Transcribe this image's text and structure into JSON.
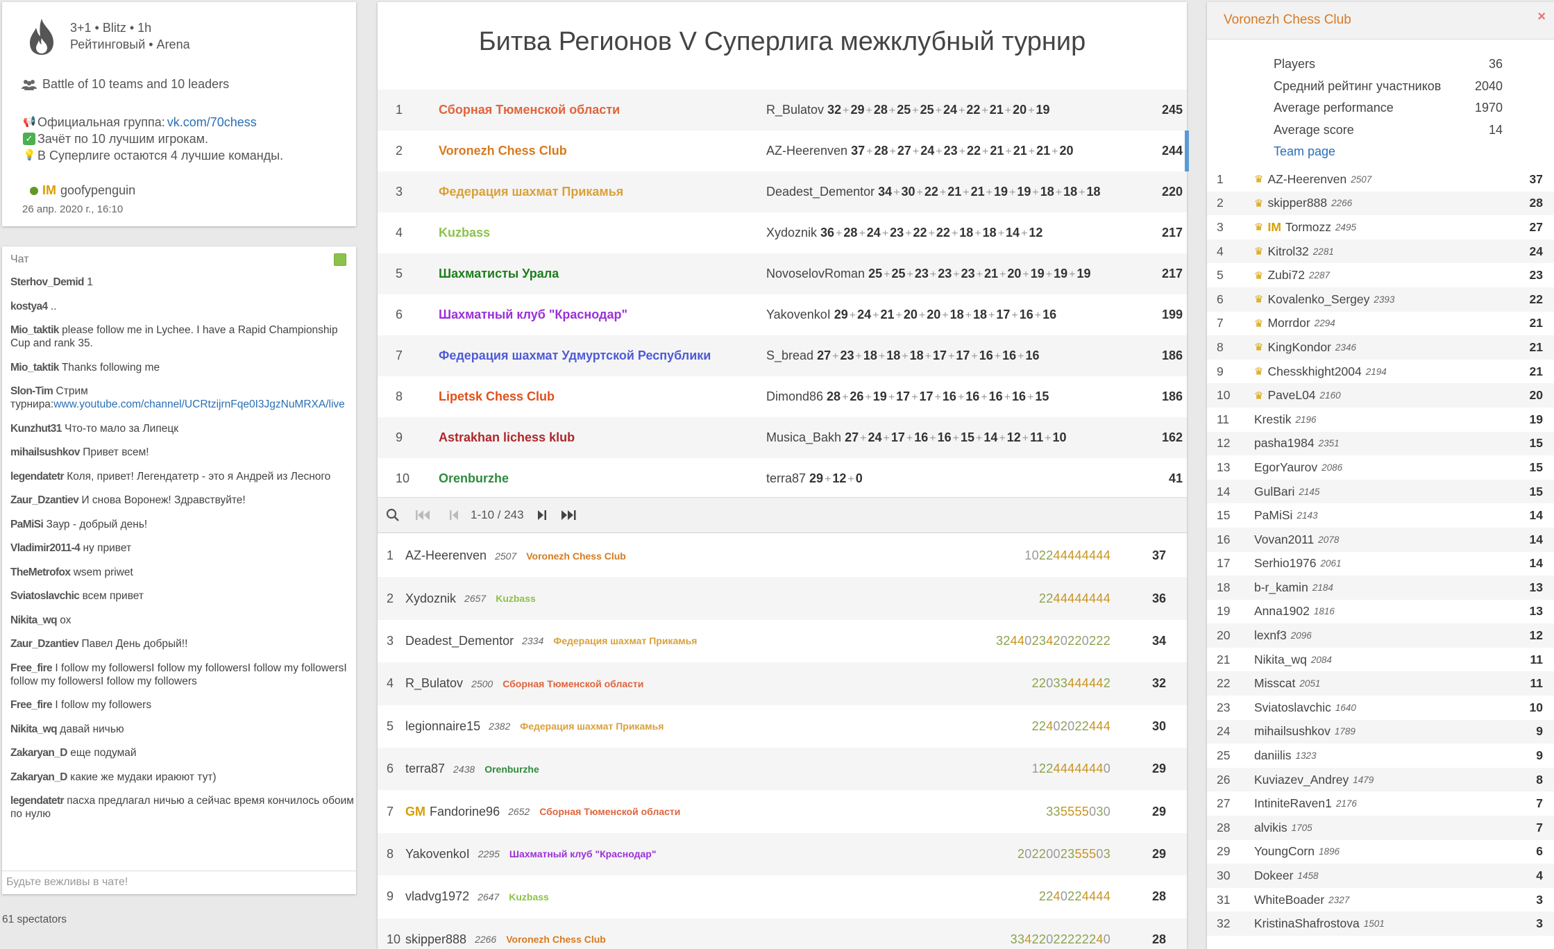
{
  "tournament": {
    "clock": "3+1 • Blitz • 1h",
    "type": "Рейтинговый • Arena",
    "battle": "Battle of 10 teams and 10 leaders",
    "desc_group_label": "Официальная группа: ",
    "desc_group_link": "vk.com/70chess",
    "desc_line2": "Зачёт по 10 лучшим игрокам.",
    "desc_line3": "В Суперлиге остаются 4 лучшие команды.",
    "creator_title": "IM",
    "creator_name": "goofypenguin",
    "date": "26 апр. 2020 г., 16:10",
    "title": "Битва Регионов V Суперлига межклубный турнир"
  },
  "chat": {
    "header": "Чат",
    "placeholder": "Будьте вежливы в чате!",
    "spectators": "61 spectators",
    "messages": [
      {
        "user": "Sterhov_Demid",
        "text": "1"
      },
      {
        "user": "kostya4",
        "text": ".."
      },
      {
        "user": "Mio_taktik",
        "text": "please follow me in Lychee. I have a Rapid Championship Cup and rank 35."
      },
      {
        "user": "Mio_taktik",
        "text": "Thanks following me"
      },
      {
        "user": "Slon-Tim",
        "text": "Стрим турнира:",
        "link": "www.youtube.com/channel/UCRtzijrnFqe0I3JgzNuMRXA/live"
      },
      {
        "user": "Kunzhut31",
        "text": "Что-то мало за Липецк"
      },
      {
        "user": "mihailsushkov",
        "text": "Привет всем!"
      },
      {
        "user": "legendatetr",
        "text": "Коля, привет! Легендатетр - это я Андрей из Лесного"
      },
      {
        "user": "Zaur_Dzantiev",
        "text": "И снова Воронеж! Здравствуйте!"
      },
      {
        "user": "PaMiSi",
        "text": "Заур - добрый день!"
      },
      {
        "user": "Vladimir2011-4",
        "text": "ну привет"
      },
      {
        "user": "TheMetrofox",
        "text": "wsem priwet"
      },
      {
        "user": "Sviatoslavchic",
        "text": "всем привет"
      },
      {
        "user": "Nikita_wq",
        "text": "ох"
      },
      {
        "user": "Zaur_Dzantiev",
        "text": "Павел День добрый!!"
      },
      {
        "user": "Free_fire",
        "text": "I follow my followersI follow my followersI follow my followersI follow my followersI follow my followers"
      },
      {
        "user": "Free_fire",
        "text": "I follow my followers"
      },
      {
        "user": "Nikita_wq",
        "text": "давай ничью"
      },
      {
        "user": "Zakaryan_D",
        "text": "еще подумай"
      },
      {
        "user": "Zakaryan_D",
        "text": "какие же мудаки ираюют тут)"
      },
      {
        "user": "legendatetr",
        "text": "пасха предлагал ничью а сейчас время кончилось обоим по нулю"
      }
    ]
  },
  "teams": [
    {
      "rank": "1",
      "name": "Сборная Тюменской области",
      "color": "#e0643c",
      "leader": "R_Bulatov",
      "scores": [
        "32",
        "29",
        "28",
        "25",
        "25",
        "24",
        "22",
        "21",
        "20",
        "19"
      ],
      "total": "245"
    },
    {
      "rank": "2",
      "name": "Voronezh Chess Club",
      "color": "#d77a20",
      "leader": "AZ-Heerenven",
      "scores": [
        "37",
        "28",
        "27",
        "24",
        "23",
        "22",
        "21",
        "21",
        "21",
        "20"
      ],
      "total": "244"
    },
    {
      "rank": "3",
      "name": "Федерация шахмат Прикамья",
      "color": "#d9a13a",
      "leader": "Deadest_Dementor",
      "scores": [
        "34",
        "30",
        "22",
        "21",
        "21",
        "19",
        "19",
        "18",
        "18",
        "18"
      ],
      "total": "220"
    },
    {
      "rank": "4",
      "name": "Kuzbass",
      "color": "#8bc34a",
      "leader": "Xydoznik",
      "scores": [
        "36",
        "28",
        "24",
        "23",
        "22",
        "22",
        "18",
        "18",
        "14",
        "12"
      ],
      "total": "217"
    },
    {
      "rank": "5",
      "name": "Шахматисты Урала",
      "color": "#1e7d1e",
      "leader": "NovoselovRoman",
      "scores": [
        "25",
        "25",
        "23",
        "23",
        "23",
        "21",
        "20",
        "19",
        "19",
        "19"
      ],
      "total": "217"
    },
    {
      "rank": "6",
      "name": "Шахматный клуб \"Краснодар\"",
      "color": "#9b30d9",
      "leader": "YakovenkoI",
      "scores": [
        "29",
        "24",
        "21",
        "20",
        "20",
        "18",
        "18",
        "17",
        "16",
        "16"
      ],
      "total": "199"
    },
    {
      "rank": "7",
      "name": "Федерация шахмат Удмуртской Республики",
      "color": "#4f5bd5",
      "leader": "S_bread",
      "scores": [
        "27",
        "23",
        "18",
        "18",
        "18",
        "17",
        "17",
        "16",
        "16",
        "16"
      ],
      "total": "186"
    },
    {
      "rank": "8",
      "name": "Lipetsk Chess Club",
      "color": "#e0501b",
      "leader": "Dimond86",
      "scores": [
        "28",
        "26",
        "19",
        "17",
        "17",
        "16",
        "16",
        "16",
        "16",
        "15"
      ],
      "total": "186"
    },
    {
      "rank": "9",
      "name": "Astrakhan lichess klub",
      "color": "#b0262a",
      "leader": "Musica_Bakh",
      "scores": [
        "27",
        "24",
        "17",
        "16",
        "16",
        "15",
        "14",
        "12",
        "11",
        "10"
      ],
      "total": "162"
    },
    {
      "rank": "10",
      "name": "Orenburzhe",
      "color": "#2e8b3e",
      "leader": "terra87",
      "scores": [
        "29",
        "12",
        "0"
      ],
      "total": "41"
    }
  ],
  "pager": {
    "text": "1-10 / 243"
  },
  "players": [
    {
      "rank": "1",
      "title": "",
      "name": "AZ-Heerenven",
      "rating": "2507",
      "team": "Voronezh Chess Club",
      "team_color": "#d77a20",
      "sheet": "102244444444",
      "score": "37"
    },
    {
      "rank": "2",
      "title": "",
      "name": "Xydoznik",
      "rating": "2657",
      "team": "Kuzbass",
      "team_color": "#8bc34a",
      "sheet": "2244444444",
      "score": "36"
    },
    {
      "rank": "3",
      "title": "",
      "name": "Deadest_Dementor",
      "rating": "2334",
      "team": "Федерация шахмат Прикамья",
      "team_color": "#d9a13a",
      "sheet": "3244023420220222",
      "score": "34"
    },
    {
      "rank": "4",
      "title": "",
      "name": "R_Bulatov",
      "rating": "2500",
      "team": "Сборная Тюменской области",
      "team_color": "#e0643c",
      "sheet": "22033444442",
      "score": "32"
    },
    {
      "rank": "5",
      "title": "",
      "name": "legionnaire15",
      "rating": "2382",
      "team": "Федерация шахмат Прикамья",
      "team_color": "#d9a13a",
      "sheet": "22402022444",
      "score": "30"
    },
    {
      "rank": "6",
      "title": "",
      "name": "terra87",
      "rating": "2438",
      "team": "Orenburzhe",
      "team_color": "#2e8b3e",
      "sheet": "12244444440",
      "score": "29"
    },
    {
      "rank": "7",
      "title": "GM",
      "name": "Fandorine96",
      "rating": "2652",
      "team": "Сборная Тюменской области",
      "team_color": "#e0643c",
      "sheet": "335555030",
      "score": "29"
    },
    {
      "rank": "8",
      "title": "",
      "name": "YakovenkoI",
      "rating": "2295",
      "team": "Шахматный клуб \"Краснодар\"",
      "team_color": "#9b30d9",
      "sheet": "2022002355503",
      "score": "29"
    },
    {
      "rank": "9",
      "title": "",
      "name": "vladvg1972",
      "rating": "2647",
      "team": "Kuzbass",
      "team_color": "#8bc34a",
      "sheet": "2240224444",
      "score": "28"
    },
    {
      "rank": "10",
      "title": "",
      "name": "skipper888",
      "rating": "2266",
      "team": "Voronezh Chess Club",
      "team_color": "#d77a20",
      "sheet": "33422022222240",
      "score": "28"
    }
  ],
  "team_panel": {
    "title": "Voronezh Chess Club",
    "close": "×",
    "stats": [
      {
        "label": "Players",
        "value": "36"
      },
      {
        "label": "Средний рейтинг участников",
        "value": "2040"
      },
      {
        "label": "Average performance",
        "value": "1970"
      },
      {
        "label": "Average score",
        "value": "14"
      }
    ],
    "team_page": "Team page",
    "players": [
      {
        "rank": "1",
        "leader": true,
        "title": "",
        "name": "AZ-Heerenven",
        "rating": "2507",
        "score": "37"
      },
      {
        "rank": "2",
        "leader": true,
        "title": "",
        "name": "skipper888",
        "rating": "2266",
        "score": "28"
      },
      {
        "rank": "3",
        "leader": true,
        "title": "IM",
        "name": "Tormozz",
        "rating": "2495",
        "score": "27"
      },
      {
        "rank": "4",
        "leader": true,
        "title": "",
        "name": "Kitrol32",
        "rating": "2281",
        "score": "24"
      },
      {
        "rank": "5",
        "leader": true,
        "title": "",
        "name": "Zubi72",
        "rating": "2287",
        "score": "23"
      },
      {
        "rank": "6",
        "leader": true,
        "title": "",
        "name": "Kovalenko_Sergey",
        "rating": "2393",
        "score": "22"
      },
      {
        "rank": "7",
        "leader": true,
        "title": "",
        "name": "Morrdor",
        "rating": "2294",
        "score": "21"
      },
      {
        "rank": "8",
        "leader": true,
        "title": "",
        "name": "KingKondor",
        "rating": "2346",
        "score": "21"
      },
      {
        "rank": "9",
        "leader": true,
        "title": "",
        "name": "Chesskhight2004",
        "rating": "2194",
        "score": "21"
      },
      {
        "rank": "10",
        "leader": true,
        "title": "",
        "name": "PaveL04",
        "rating": "2160",
        "score": "20"
      },
      {
        "rank": "11",
        "leader": false,
        "title": "",
        "name": "Krestik",
        "rating": "2196",
        "score": "19"
      },
      {
        "rank": "12",
        "leader": false,
        "title": "",
        "name": "pasha1984",
        "rating": "2351",
        "score": "15"
      },
      {
        "rank": "13",
        "leader": false,
        "title": "",
        "name": "EgorYaurov",
        "rating": "2086",
        "score": "15"
      },
      {
        "rank": "14",
        "leader": false,
        "title": "",
        "name": "GulBari",
        "rating": "2145",
        "score": "15"
      },
      {
        "rank": "15",
        "leader": false,
        "title": "",
        "name": "PaMiSi",
        "rating": "2143",
        "score": "14"
      },
      {
        "rank": "16",
        "leader": false,
        "title": "",
        "name": "Vovan2011",
        "rating": "2078",
        "score": "14"
      },
      {
        "rank": "17",
        "leader": false,
        "title": "",
        "name": "Serhio1976",
        "rating": "2061",
        "score": "14"
      },
      {
        "rank": "18",
        "leader": false,
        "title": "",
        "name": "b-r_kamin",
        "rating": "2184",
        "score": "13"
      },
      {
        "rank": "19",
        "leader": false,
        "title": "",
        "name": "Anna1902",
        "rating": "1816",
        "score": "13"
      },
      {
        "rank": "20",
        "leader": false,
        "title": "",
        "name": "lexnf3",
        "rating": "2096",
        "score": "12"
      },
      {
        "rank": "21",
        "leader": false,
        "title": "",
        "name": "Nikita_wq",
        "rating": "2084",
        "score": "11"
      },
      {
        "rank": "22",
        "leader": false,
        "title": "",
        "name": "Misscat",
        "rating": "2051",
        "score": "11"
      },
      {
        "rank": "23",
        "leader": false,
        "title": "",
        "name": "Sviatoslavchic",
        "rating": "1640",
        "score": "10"
      },
      {
        "rank": "24",
        "leader": false,
        "title": "",
        "name": "mihailsushkov",
        "rating": "1789",
        "score": "9"
      },
      {
        "rank": "25",
        "leader": false,
        "title": "",
        "name": "daniilis",
        "rating": "1323",
        "score": "9"
      },
      {
        "rank": "26",
        "leader": false,
        "title": "",
        "name": "Kuviazev_Andrey",
        "rating": "1479",
        "score": "8"
      },
      {
        "rank": "27",
        "leader": false,
        "title": "",
        "name": "IntiniteRaven1",
        "rating": "2176",
        "score": "7"
      },
      {
        "rank": "28",
        "leader": false,
        "title": "",
        "name": "alvikis",
        "rating": "1705",
        "score": "7"
      },
      {
        "rank": "29",
        "leader": false,
        "title": "",
        "name": "YoungCorn",
        "rating": "1896",
        "score": "6"
      },
      {
        "rank": "30",
        "leader": false,
        "title": "",
        "name": "Dokeer",
        "rating": "1458",
        "score": "4"
      },
      {
        "rank": "31",
        "leader": false,
        "title": "",
        "name": "WhiteBoader",
        "rating": "2327",
        "score": "3"
      },
      {
        "rank": "32",
        "leader": false,
        "title": "",
        "name": "KristinaShafrostova",
        "rating": "1501",
        "score": "3"
      }
    ]
  }
}
